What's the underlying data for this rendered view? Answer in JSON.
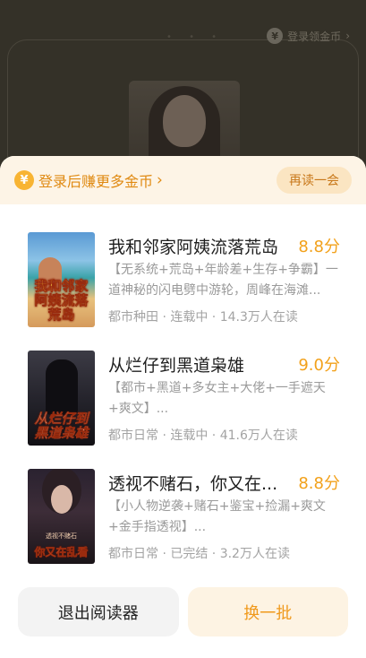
{
  "background": {
    "coin_label": "登录领金币",
    "coin_icon": "¥"
  },
  "banner": {
    "coin_icon": "¥",
    "text": "登录后赚更多金币",
    "chevron": "›",
    "again_label": "再读一会"
  },
  "books": [
    {
      "title": "我和邻家阿姨流落荒岛",
      "score": "8.8分",
      "desc": "【无系统+荒岛+年龄差+生存+争霸】一道神秘的闪电劈中游轮，周峰在海滩...",
      "meta": "都市种田 · 连载中 · 14.3万人在读",
      "cover_text": "我和邻家阿姨流落荒岛"
    },
    {
      "title": "从烂仔到黑道枭雄",
      "score": "9.0分",
      "desc": "【都市+黑道+多女主+大佬+一手遮天+爽文】...",
      "meta": "都市日常 · 连载中 · 41.6万人在读",
      "cover_text": "从烂仔到黑道枭雄"
    },
    {
      "title": "透视不赌石，你又在...",
      "score": "8.8分",
      "desc": "【小人物逆袭+赌石+鉴宝+捡漏+爽文+金手指透视】...",
      "meta": "都市日常 · 已完结 · 3.2万人在读",
      "cover_text": "你又在乱看",
      "cover_small": "透视不赌石"
    }
  ],
  "actions": {
    "exit_label": "退出阅读器",
    "swap_label": "换一批"
  },
  "colors": {
    "accent": "#f2a11b",
    "banner_bg": "#fdf4e6"
  }
}
